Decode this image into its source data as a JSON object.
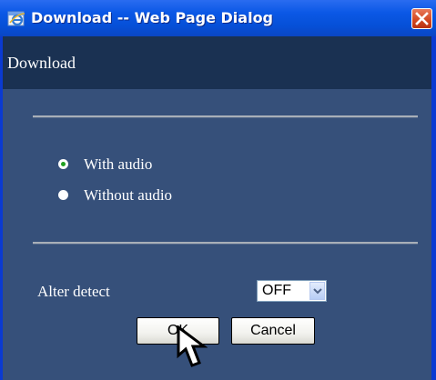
{
  "window": {
    "title": "Download -- Web Page Dialog"
  },
  "header": {
    "label": "Download"
  },
  "options": [
    {
      "label": "With audio",
      "selected": true
    },
    {
      "label": "Without audio",
      "selected": false
    }
  ],
  "alter_detect": {
    "label": "Alter detect",
    "value": "OFF"
  },
  "buttons": {
    "ok": "OK",
    "cancel": "Cancel"
  },
  "colors": {
    "titlebar": "#0650d8",
    "panel": "#36507a",
    "header_band": "#1a3152",
    "radio_selected": "#21a121"
  }
}
